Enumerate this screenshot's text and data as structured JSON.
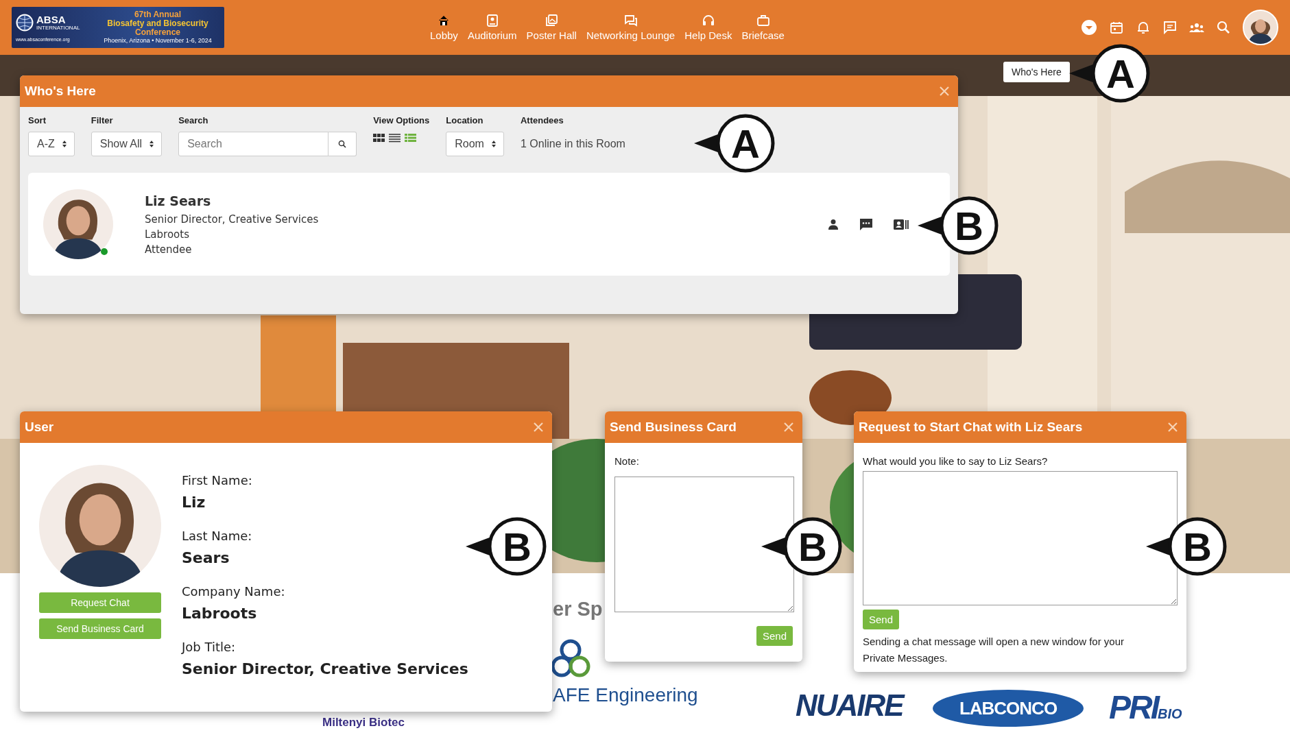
{
  "header": {
    "logo": {
      "org": "ABSA",
      "org_sub": "INTERNATIONAL",
      "url": "www.absaconference.org",
      "edition": "67th Annual",
      "title_1": "Biosafety and Biosecurity",
      "title_2": "Conference",
      "place": "Phoenix, Arizona • November 1-6, 2024"
    },
    "nav": [
      {
        "label": "Lobby"
      },
      {
        "label": "Auditorium"
      },
      {
        "label": "Poster Hall"
      },
      {
        "label": "Networking Lounge"
      },
      {
        "label": "Help Desk"
      },
      {
        "label": "Briefcase"
      }
    ]
  },
  "tooltip": "Who's Here",
  "whos_here": {
    "title": "Who's Here",
    "controls": [
      {
        "kind": "select",
        "label": "Sort",
        "value": "A-Z"
      },
      {
        "kind": "select",
        "label": "Filter",
        "value": "Show All"
      },
      {
        "kind": "search",
        "label": "Search",
        "placeholder": "Search"
      },
      {
        "kind": "views",
        "label": "View Options",
        "views": [
          {
            "selected": false
          },
          {
            "selected": false
          },
          {
            "selected": true
          }
        ]
      },
      {
        "kind": "select",
        "label": "Location",
        "value": "Room"
      },
      {
        "kind": "text",
        "label": "Attendees",
        "value": "1 Online in this Room"
      }
    ],
    "attendees": [
      {
        "name": "Liz Sears",
        "title": "Senior Director, Creative Services",
        "company": "Labroots",
        "role": "Attendee",
        "online": true
      }
    ]
  },
  "user": {
    "title": "User",
    "buttons": [
      "Request Chat",
      "Send Business Card"
    ],
    "fields": [
      {
        "label": "First Name:",
        "value": "Liz"
      },
      {
        "label": "Last Name:",
        "value": "Sears"
      },
      {
        "label": "Company Name:",
        "value": "Labroots"
      },
      {
        "label": "Job Title:",
        "value": "Senior Director, Creative Services"
      }
    ]
  },
  "business_card": {
    "title": "Send Business Card",
    "note_label": "Note:",
    "send": "Send"
  },
  "chat": {
    "title": "Request to Start Chat with Liz Sears",
    "prompt": "What would you like to say to Liz Sears?",
    "send": "Send",
    "notice": "Sending a chat message will open a new window for your Private Messages."
  },
  "sponsors": {
    "heading": "er Sp",
    "logos": [
      {
        "kind": "afe",
        "text": "AFE Engineering"
      },
      {
        "kind": "miltenyi",
        "text": "Miltenyi Biotec"
      },
      {
        "kind": "nuaire",
        "text": "NUAIRE"
      },
      {
        "kind": "labconco",
        "text": "LABCONCO"
      },
      {
        "kind": "pri",
        "text": "PRI",
        "sub": "BIO"
      }
    ]
  },
  "callouts": [
    {
      "letter": "A"
    },
    {
      "letter": "A"
    },
    {
      "letter": "B"
    },
    {
      "letter": "B"
    },
    {
      "letter": "B"
    },
    {
      "letter": "B"
    }
  ]
}
